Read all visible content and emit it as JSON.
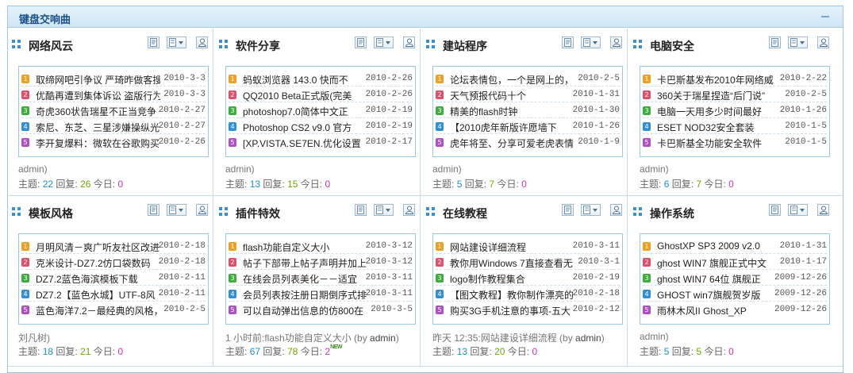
{
  "section_title": "键盘交响曲",
  "stats_labels": {
    "topics": "主题:",
    "replies": "回复:",
    "today": "今日:"
  },
  "icons": {
    "header": "collapse-icon",
    "panel": "grid-icon",
    "tools": [
      "post-icon",
      "view-list-icon",
      "user-icon"
    ]
  },
  "colors": {
    "accent": "#1a4f8a",
    "border": "#9cc8e3",
    "topics": "#1e90c8",
    "replies": "#70a800",
    "today": "#cc33aa",
    "badges": [
      "#f0a020",
      "#e0506a",
      "#3cae3c",
      "#2f8fd8",
      "#b050c8"
    ]
  },
  "forums": [
    {
      "title": "网络风云",
      "threads": [
        {
          "no": "1",
          "title": "取缔网吧引争议 严琦昨做客搜",
          "date": "2010-3-3"
        },
        {
          "no": "2",
          "title": "优酷再遭到集体诉讼 盗版行为",
          "date": "2010-3-3"
        },
        {
          "no": "3",
          "title": "奇虎360状告瑞星不正当竞争",
          "date": "2010-2-27"
        },
        {
          "no": "4",
          "title": "索尼、东芝、三星涉嫌操纵光",
          "date": "2010-2-27"
        },
        {
          "no": "5",
          "title": "李开复爆料：微软在谷歌购买",
          "date": "2010-2-26"
        }
      ],
      "last_post": "admin)",
      "last_user": "",
      "topics": "22",
      "replies": "26",
      "today": "0",
      "is_new": false
    },
    {
      "title": "软件分享",
      "threads": [
        {
          "no": "1",
          "title": "蚂蚁浏览器 143.0 快而不",
          "date": "2010-2-26"
        },
        {
          "no": "2",
          "title": "QQ2010 Beta正式版(完美",
          "date": "2010-2-26"
        },
        {
          "no": "3",
          "title": "photoshop7.0简体中文正",
          "date": "2010-2-19"
        },
        {
          "no": "4",
          "title": "Photoshop CS2 v9.0 官方",
          "date": "2010-2-19"
        },
        {
          "no": "5",
          "title": "[XP.VISTA.SE7EN.优化设置",
          "date": "2010-2-17"
        }
      ],
      "last_post": "admin)",
      "last_user": "",
      "topics": "13",
      "replies": "15",
      "today": "0",
      "is_new": false
    },
    {
      "title": "建站程序",
      "threads": [
        {
          "no": "1",
          "title": "论坛表情包，一个是网上的，",
          "date": "2010-2-5"
        },
        {
          "no": "2",
          "title": "天气预报代码十个",
          "date": "2010-1-31"
        },
        {
          "no": "3",
          "title": "精美的flash时钟",
          "date": "2010-1-30"
        },
        {
          "no": "4",
          "title": "【2010虎年新版许愿墙下",
          "date": "2010-1-26"
        },
        {
          "no": "5",
          "title": "虎年将至、分享可爱老虎表情",
          "date": "2010-1-9"
        }
      ],
      "last_post": "admin)",
      "last_user": "",
      "topics": "5",
      "replies": "7",
      "today": "0",
      "is_new": false
    },
    {
      "title": "电脑安全",
      "threads": [
        {
          "no": "1",
          "title": "卡巴斯基发布2010年网络威",
          "date": "2010-2-22"
        },
        {
          "no": "2",
          "title": "360关于瑞星捏造“后门说”",
          "date": "2010-2-5"
        },
        {
          "no": "3",
          "title": "电脑一天用多少时间最好",
          "date": "2010-1-26"
        },
        {
          "no": "4",
          "title": "ESET NOD32安全套装",
          "date": "2010-1-5"
        },
        {
          "no": "5",
          "title": "卡巴斯基全功能安全软件",
          "date": "2010-1-5"
        }
      ],
      "last_post": "admin)",
      "last_user": "",
      "topics": "6",
      "replies": "7",
      "today": "0",
      "is_new": false
    },
    {
      "title": "模板风格",
      "threads": [
        {
          "no": "1",
          "title": "月明风清－爽广听友社区改进",
          "date": "2010-2-18"
        },
        {
          "no": "2",
          "title": "克米设计-DZ7.2仿口袋数码",
          "date": "2010-2-18"
        },
        {
          "no": "3",
          "title": "DZ7.2蓝色海滨模板下载",
          "date": "2010-2-11"
        },
        {
          "no": "4",
          "title": "DZ7.2【蓝色水城】UTF-8风",
          "date": "2010-2-11"
        },
        {
          "no": "5",
          "title": "蓝色海洋7.2－最经典的风格，",
          "date": "2010-2-5"
        }
      ],
      "last_post": "刘凡树)",
      "last_user": "",
      "topics": "18",
      "replies": "21",
      "today": "0",
      "is_new": false
    },
    {
      "title": "插件特效",
      "threads": [
        {
          "no": "1",
          "title": "flash功能自定义大小",
          "date": "2010-3-12"
        },
        {
          "no": "2",
          "title": "帖子下部带上帖子声明并加上",
          "date": "2010-3-12"
        },
        {
          "no": "3",
          "title": "在线会员列表美化－－适宜",
          "date": "2010-3-11"
        },
        {
          "no": "4",
          "title": "会员列表按注册日期倒序式排",
          "date": "2010-3-11"
        },
        {
          "no": "5",
          "title": "可以自动弹出信息的仿800在",
          "date": "2010-3-5"
        }
      ],
      "last_post": "1 小时前:flash功能自定义大小 (by ",
      "last_user": "admin",
      "last_tail": ")",
      "topics": "67",
      "replies": "78",
      "today": "2",
      "is_new": true,
      "new_label": "NEW"
    },
    {
      "title": "在线教程",
      "threads": [
        {
          "no": "1",
          "title": "网站建设详细流程",
          "date": "2010-3-11"
        },
        {
          "no": "2",
          "title": "教你用Windows 7直接查看无",
          "date": "2010-3-1"
        },
        {
          "no": "3",
          "title": "logo制作教程集合",
          "date": "2010-2-19"
        },
        {
          "no": "4",
          "title": "【图文教程】教你制作漂亮的",
          "date": "2010-2-18"
        },
        {
          "no": "5",
          "title": "购买3G手机注意的事项-五大",
          "date": "2010-2-12"
        }
      ],
      "last_post": "昨天 12:35:网站建设详细流程 (by ",
      "last_user": "admin",
      "last_tail": ")",
      "topics": "13",
      "replies": "20",
      "today": "0",
      "is_new": false
    },
    {
      "title": "操作系统",
      "threads": [
        {
          "no": "1",
          "title": "GhostXP SP3 2009 v2.0",
          "date": "2010-1-31"
        },
        {
          "no": "2",
          "title": "ghost WIN7 旗舰正式中文",
          "date": "2010-1-17"
        },
        {
          "no": "3",
          "title": "ghost WIN7 64位 旗舰正",
          "date": "2009-12-26"
        },
        {
          "no": "4",
          "title": "GHOST win7旗舰贺岁版",
          "date": "2009-12-26"
        },
        {
          "no": "5",
          "title": "雨林木风II  Ghost_XP",
          "date": "2009-12-26"
        }
      ],
      "last_post": "admin)",
      "last_user": "",
      "topics": "5",
      "replies": "5",
      "today": "0",
      "is_new": false
    }
  ]
}
